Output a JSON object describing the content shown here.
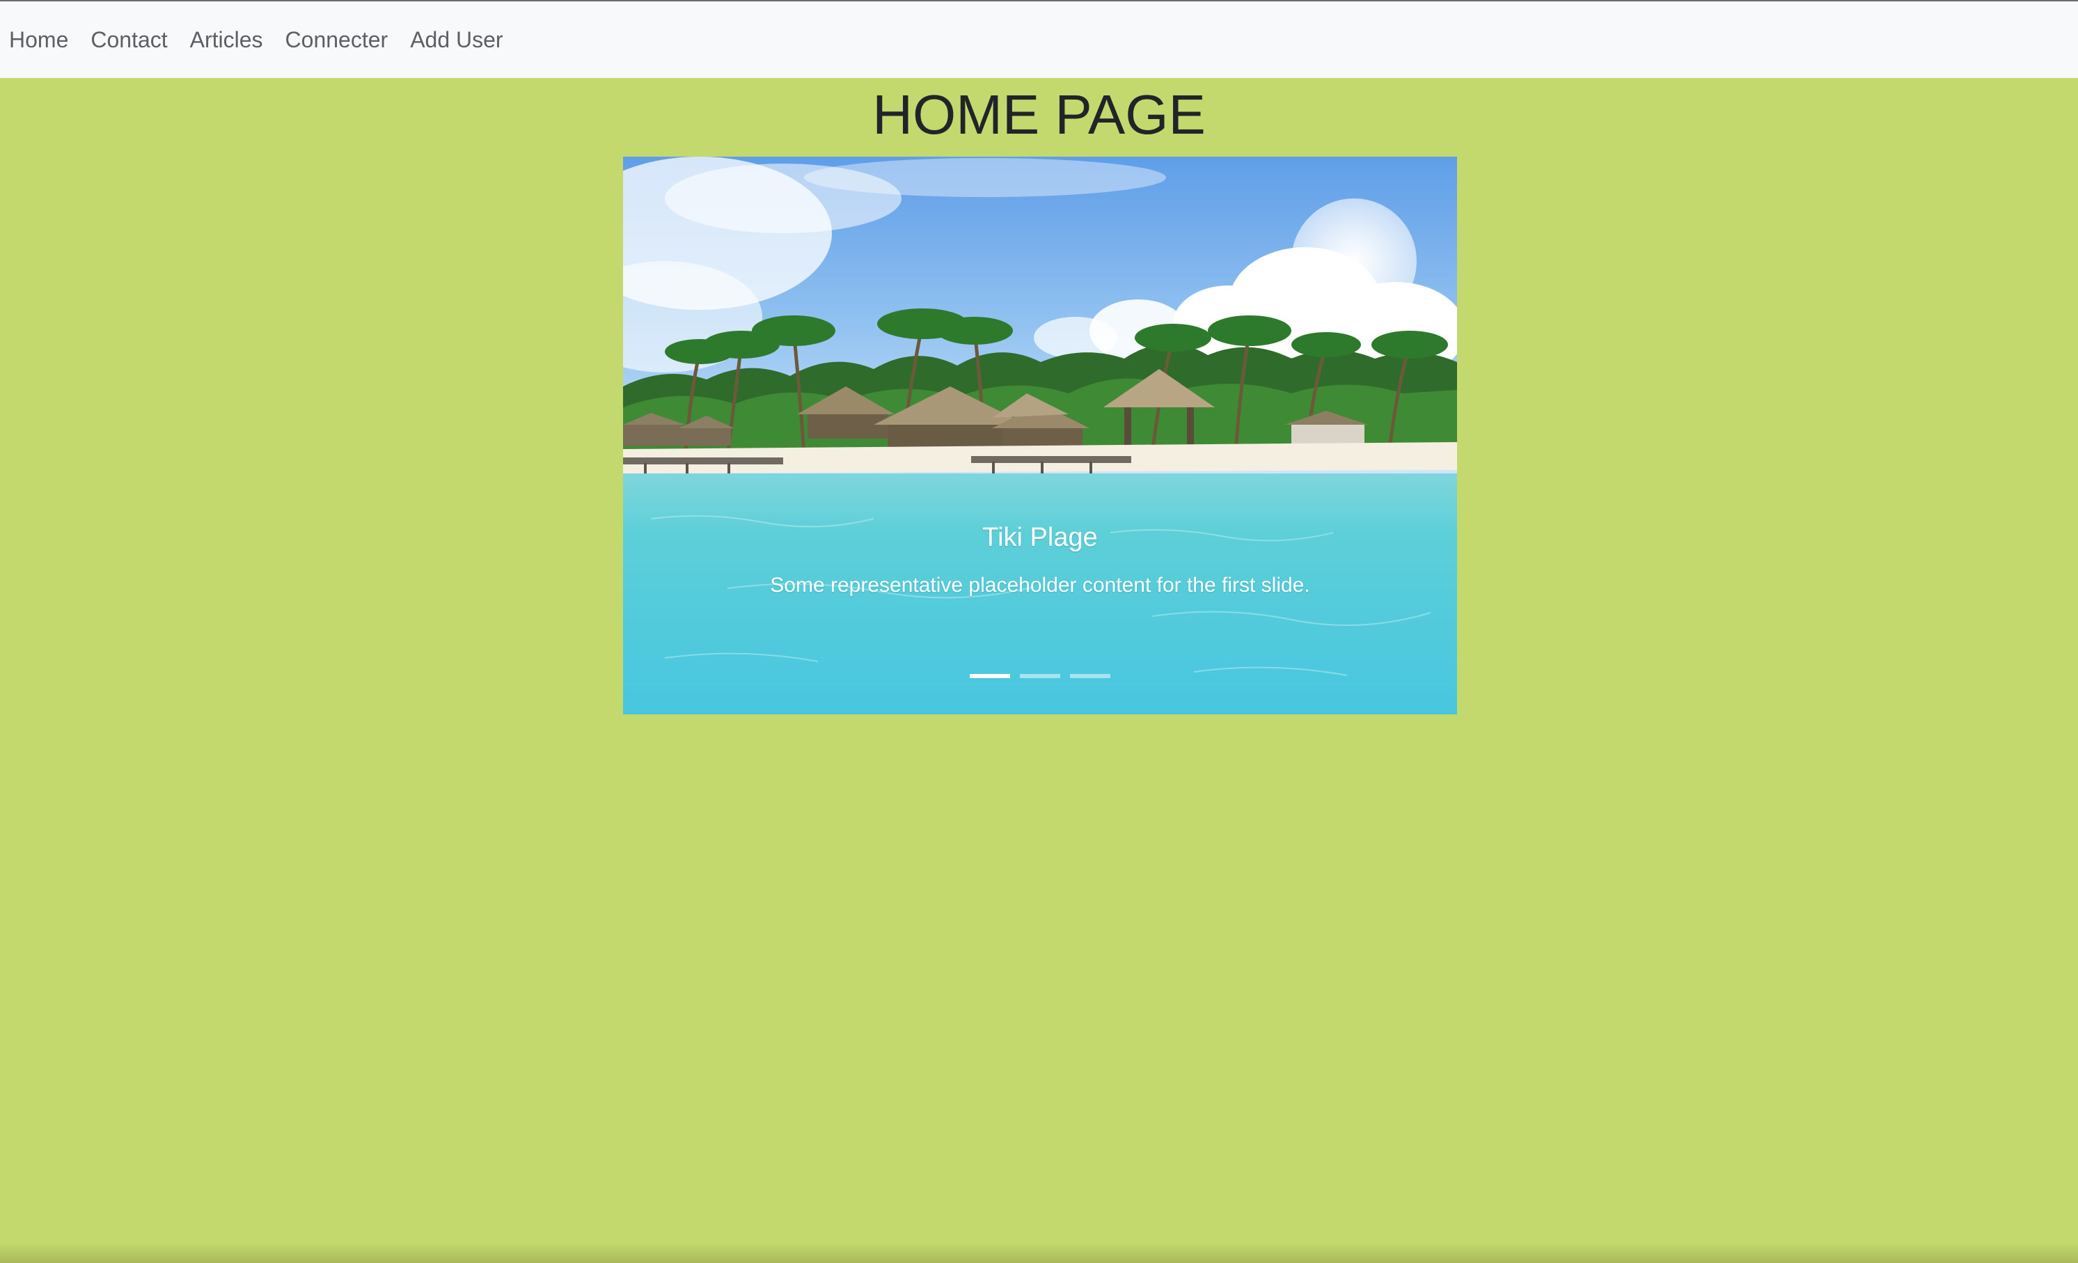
{
  "nav": {
    "items": [
      {
        "label": "Home"
      },
      {
        "label": "Contact"
      },
      {
        "label": "Articles"
      },
      {
        "label": "Connecter"
      },
      {
        "label": "Add User"
      }
    ]
  },
  "page": {
    "title": "HOME PAGE",
    "background_color": "#c3d96d"
  },
  "carousel": {
    "caption_title": "Tiki Plage",
    "caption_text": "Some representative placeholder content for the first slide.",
    "indicator_count": 3,
    "active_index": 0
  }
}
